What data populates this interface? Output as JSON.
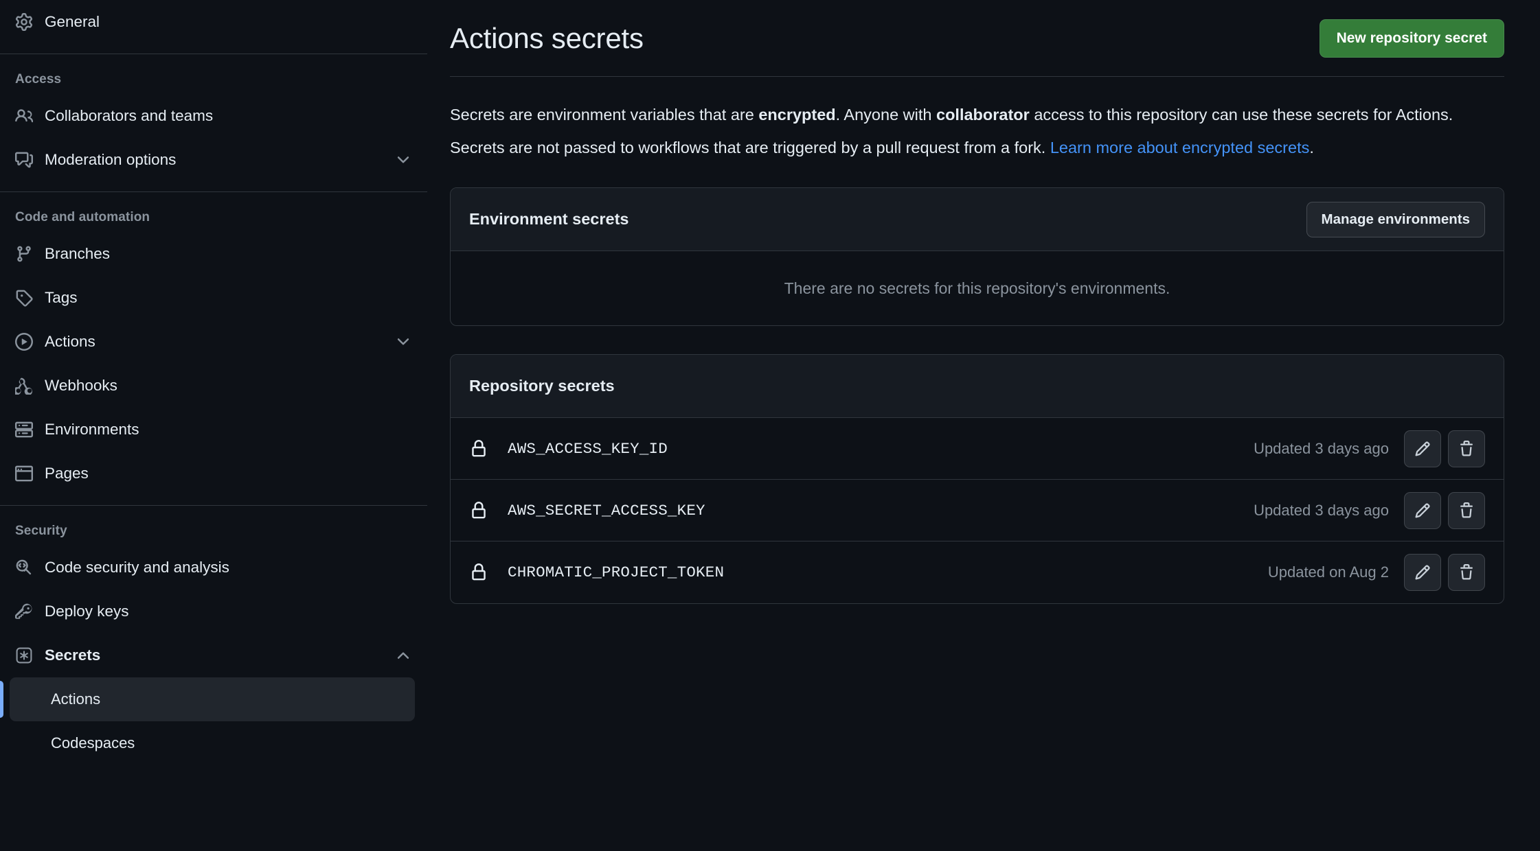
{
  "sidebar": {
    "top_items": [
      {
        "label": "General",
        "icon": "gear-icon",
        "key": "general"
      }
    ],
    "groups": [
      {
        "label": "Access",
        "items": [
          {
            "label": "Collaborators and teams",
            "icon": "people-icon",
            "key": "collaborators-and-teams",
            "chevron": ""
          },
          {
            "label": "Moderation options",
            "icon": "comment-discussion-icon",
            "key": "moderation-options",
            "chevron": "down"
          }
        ]
      },
      {
        "label": "Code and automation",
        "items": [
          {
            "label": "Branches",
            "icon": "git-branch-icon",
            "key": "branches",
            "chevron": ""
          },
          {
            "label": "Tags",
            "icon": "tag-icon",
            "key": "tags",
            "chevron": ""
          },
          {
            "label": "Actions",
            "icon": "play-icon",
            "key": "actions",
            "chevron": "down"
          },
          {
            "label": "Webhooks",
            "icon": "webhook-icon",
            "key": "webhooks",
            "chevron": ""
          },
          {
            "label": "Environments",
            "icon": "server-icon",
            "key": "environments",
            "chevron": ""
          },
          {
            "label": "Pages",
            "icon": "browser-icon",
            "key": "pages",
            "chevron": ""
          }
        ]
      },
      {
        "label": "Security",
        "items": [
          {
            "label": "Code security and analysis",
            "icon": "codescan-icon",
            "key": "code-security-and-analysis",
            "chevron": ""
          },
          {
            "label": "Deploy keys",
            "icon": "key-icon",
            "key": "deploy-keys",
            "chevron": ""
          },
          {
            "label": "Secrets",
            "icon": "asterisk-key-icon",
            "key": "secrets",
            "chevron": "up",
            "bold": true
          }
        ],
        "sub_items": [
          {
            "label": "Actions",
            "key": "secrets-actions",
            "active": true
          },
          {
            "label": "Codespaces",
            "key": "secrets-codespaces",
            "active": false
          }
        ]
      }
    ]
  },
  "header": {
    "title": "Actions secrets",
    "new_secret_button": "New repository secret"
  },
  "description": {
    "p1_a": "Secrets are environment variables that are ",
    "p1_b": "encrypted",
    "p1_c": ". Anyone with ",
    "p1_d": "collaborator",
    "p1_e": " access to this repository can use these secrets for Actions.",
    "p2_a": "Secrets are not passed to workflows that are triggered by a pull request from a fork. ",
    "p2_link": "Learn more about encrypted secrets",
    "p2_b": "."
  },
  "environment_secrets": {
    "title": "Environment secrets",
    "manage_button": "Manage environments",
    "empty_message": "There are no secrets for this repository's environments."
  },
  "repository_secrets": {
    "title": "Repository secrets",
    "rows": [
      {
        "name": "AWS_ACCESS_KEY_ID",
        "updated": "Updated 3 days ago"
      },
      {
        "name": "AWS_SECRET_ACCESS_KEY",
        "updated": "Updated 3 days ago"
      },
      {
        "name": "CHROMATIC_PROJECT_TOKEN",
        "updated": "Updated on Aug 2"
      }
    ]
  },
  "colors": {
    "background": "#0d1117",
    "panel_header": "#161b22",
    "border": "#30363d",
    "accent_green": "#347d39",
    "accent_blue": "#4493f8",
    "active_indicator": "#7aadfa",
    "muted_text": "#8b949e"
  }
}
